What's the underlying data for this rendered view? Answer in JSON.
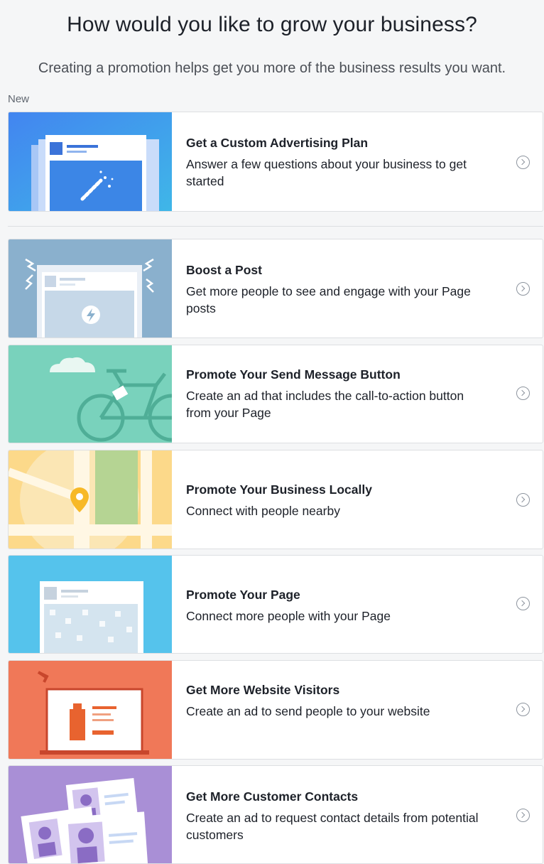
{
  "page": {
    "title": "How would you like to grow your business?",
    "subtitle": "Creating a promotion helps get you more of the business results you want.",
    "section_label": "New"
  },
  "cards": [
    {
      "title": "Get a Custom Advertising Plan",
      "description": "Answer a few questions about your business to get started",
      "icon": "magic-wand-illustration",
      "thumb_color": "#3578e5"
    },
    {
      "title": "Boost a Post",
      "description": "Get more people to see and engage with your Page posts",
      "icon": "lightning-bolt-illustration",
      "thumb_color": "#7ea8c8"
    },
    {
      "title": "Promote Your Send Message Button",
      "description": "Create an ad that includes the call-to-action button from your Page",
      "icon": "bicycle-illustration",
      "thumb_color": "#6fcfb8"
    },
    {
      "title": "Promote Your Business Locally",
      "description": "Connect with people nearby",
      "icon": "map-pin-illustration",
      "thumb_color": "#fbd97e"
    },
    {
      "title": "Promote Your Page",
      "description": "Connect more people with your Page",
      "icon": "page-likes-illustration",
      "thumb_color": "#55c3ec"
    },
    {
      "title": "Get More Website Visitors",
      "description": "Create an ad to send people to your website",
      "icon": "website-illustration",
      "thumb_color": "#f07858"
    },
    {
      "title": "Get More Customer Contacts",
      "description": "Create an ad to request contact details from potential customers",
      "icon": "contact-cards-illustration",
      "thumb_color": "#a98fd6"
    }
  ],
  "colors": {
    "background": "#f5f6f7",
    "card_border": "#dddfe2",
    "text": "#1d2129",
    "secondary_text": "#4b4f56"
  }
}
